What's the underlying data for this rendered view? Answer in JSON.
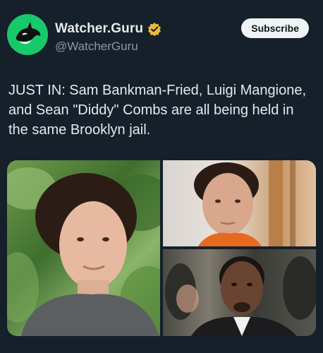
{
  "account": {
    "display_name": "Watcher.Guru",
    "handle": "@WatcherGuru",
    "avatar_icon": "orca-icon",
    "verified_icon": "verified-badge-icon",
    "brand_color": "#18c96b",
    "badge_color": "#e8b93a"
  },
  "actions": {
    "subscribe_label": "Subscribe"
  },
  "tweet": {
    "text": "JUST IN: Sam Bankman-Fried, Luigi Mangione, and Sean \"Diddy\" Combs are all being held in the same Brooklyn jail."
  },
  "media": {
    "images": [
      {
        "name": "photo-sam-bankman-fried"
      },
      {
        "name": "photo-luigi-mangione"
      },
      {
        "name": "photo-sean-combs"
      }
    ]
  }
}
